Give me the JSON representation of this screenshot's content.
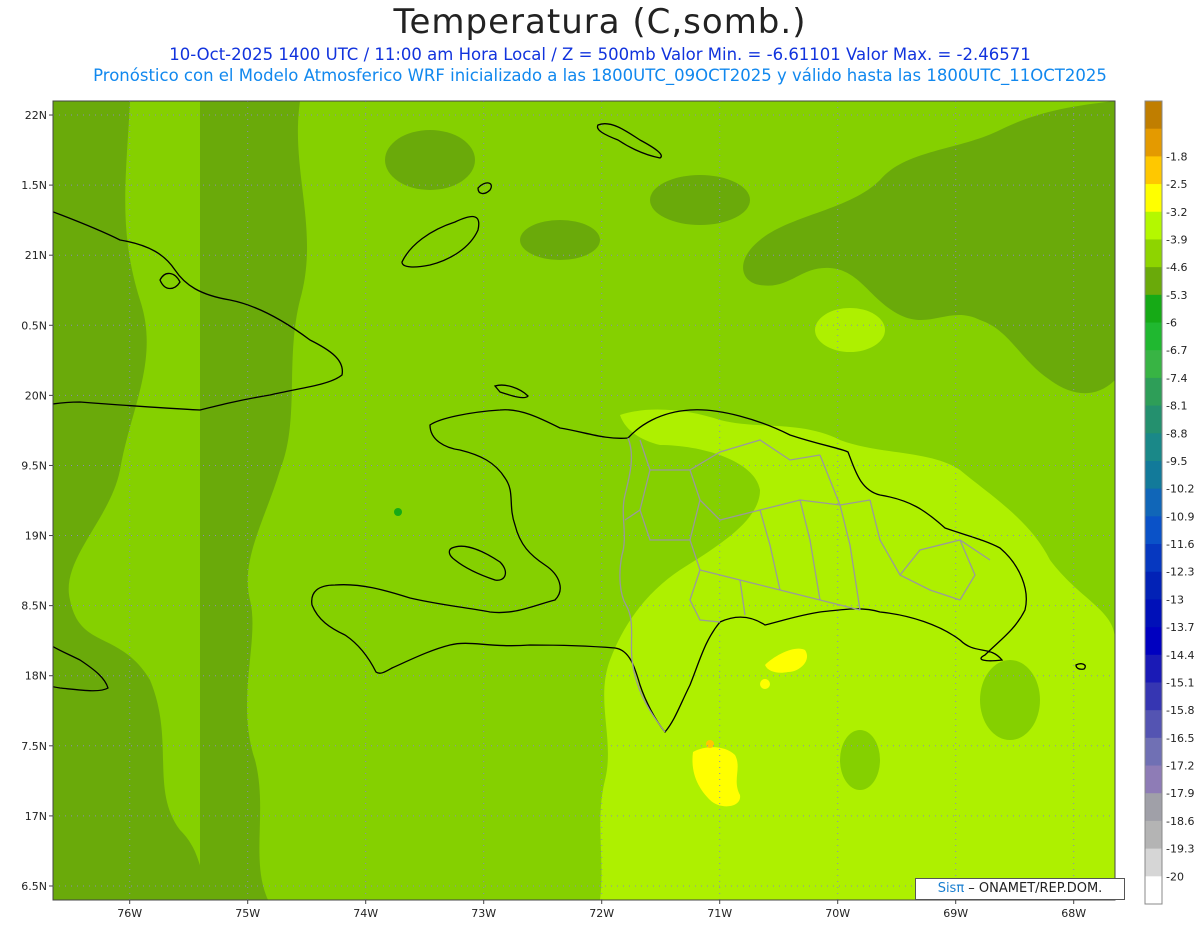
{
  "title": "Temperatura (C,somb.)",
  "subtitle_1": "10-Oct-2025  1400 UTC / 11:00 am Hora Local / Z = 500mb  Valor Min. = -6.61101  Valor Max. = -2.46571",
  "subtitle_2": "Pronóstico con el Modelo Atmosferico WRF inicializado a las 1800UTC_09OCT2025 y válido hasta las  1800UTC_11OCT2025",
  "credit": {
    "brand": "Sisπ",
    "text": " – ONAMET/REP.DOM."
  },
  "colors": {
    "dark_green": "#6aaa0a",
    "mid_green": "#85d000",
    "light_green": "#aef000",
    "yellow": "#ffff00",
    "coast": "#000000",
    "provinces": "#9a9a9a"
  },
  "map": {
    "lon_range": [
      -76.65,
      -67.65
    ],
    "lat_range": [
      16.4,
      22.1
    ],
    "lat_labels": [
      {
        "lat": 22.0,
        "label": "22N"
      },
      {
        "lat": 21.5,
        "label": "1.5N"
      },
      {
        "lat": 21.0,
        "label": "21N"
      },
      {
        "lat": 20.5,
        "label": "0.5N"
      },
      {
        "lat": 20.0,
        "label": "20N"
      },
      {
        "lat": 19.5,
        "label": "9.5N"
      },
      {
        "lat": 19.0,
        "label": "19N"
      },
      {
        "lat": 18.5,
        "label": "8.5N"
      },
      {
        "lat": 18.0,
        "label": "18N"
      },
      {
        "lat": 17.5,
        "label": "7.5N"
      },
      {
        "lat": 17.0,
        "label": "17N"
      },
      {
        "lat": 16.5,
        "label": "6.5N"
      }
    ],
    "lon_labels": [
      {
        "lon": -76,
        "label": "76W"
      },
      {
        "lon": -75,
        "label": "75W"
      },
      {
        "lon": -74,
        "label": "74W"
      },
      {
        "lon": -73,
        "label": "73W"
      },
      {
        "lon": -72,
        "label": "72W"
      },
      {
        "lon": -71,
        "label": "71W"
      },
      {
        "lon": -70,
        "label": "70W"
      },
      {
        "lon": -69,
        "label": "69W"
      },
      {
        "lon": -68,
        "label": "68W"
      }
    ]
  },
  "colorbar": [
    {
      "label": "",
      "color": "#c07e00"
    },
    {
      "label": "-1.8",
      "color": "#e49a00"
    },
    {
      "label": "-2.5",
      "color": "#ffc800"
    },
    {
      "label": "-3.2",
      "color": "#ffff00"
    },
    {
      "label": "-3.9",
      "color": "#b4f800"
    },
    {
      "label": "-4.6",
      "color": "#8ed400"
    },
    {
      "label": "-5.3",
      "color": "#6aaa0a"
    },
    {
      "label": "-6",
      "color": "#16aa16"
    },
    {
      "label": "-6.7",
      "color": "#20b830"
    },
    {
      "label": "-7.4",
      "color": "#38b444"
    },
    {
      "label": "-8.1",
      "color": "#2e9e58"
    },
    {
      "label": "-8.8",
      "color": "#24906e"
    },
    {
      "label": "-9.5",
      "color": "#1a8888"
    },
    {
      "label": "-10.2",
      "color": "#127a9a"
    },
    {
      "label": "-10.9",
      "color": "#1066b8"
    },
    {
      "label": "-11.6",
      "color": "#0a52c8"
    },
    {
      "label": "-12.3",
      "color": "#0638c0"
    },
    {
      "label": "-13",
      "color": "#0222b6"
    },
    {
      "label": "-13.7",
      "color": "#0010b8"
    },
    {
      "label": "-14.4",
      "color": "#0000c0"
    },
    {
      "label": "-15.1",
      "color": "#1a1ab6"
    },
    {
      "label": "-15.8",
      "color": "#3636b2"
    },
    {
      "label": "-16.5",
      "color": "#5454b2"
    },
    {
      "label": "-17.2",
      "color": "#7070b4"
    },
    {
      "label": "-17.9",
      "color": "#8e7cb6"
    },
    {
      "label": "-18.6",
      "color": "#a0a0a8"
    },
    {
      "label": "-19.3",
      "color": "#b4b4b4"
    },
    {
      "label": "-20",
      "color": "#d6d6d6"
    },
    {
      "label": "",
      "color": "#ffffff"
    }
  ]
}
